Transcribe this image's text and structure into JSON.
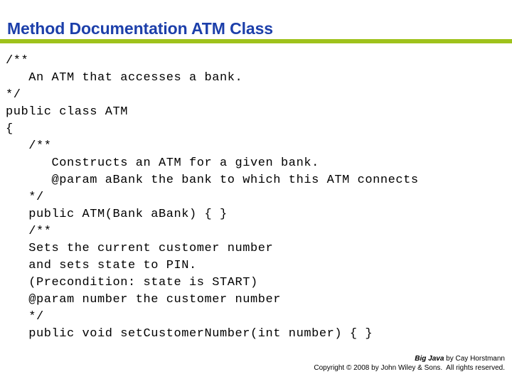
{
  "slide": {
    "title": "Method Documentation ATM Class",
    "accent_color": "#9fc21b",
    "title_color": "#1c3faa",
    "background_color": "#ffffff",
    "text_color": "#000000"
  },
  "code": {
    "language": "java",
    "lines": [
      "/**",
      "   An ATM that accesses a bank.",
      "*/",
      "public class ATM",
      "{",
      "   /**",
      "      Constructs an ATM for a given bank.",
      "      @param aBank the bank to which this ATM connects",
      "   */",
      "   public ATM(Bank aBank) { }",
      "   /**",
      "   Sets the current customer number",
      "   and sets state to PIN.",
      "   (Precondition: state is START)",
      "   @param number the customer number",
      "   */",
      "   public void setCustomerNumber(int number) { }"
    ]
  },
  "footer": {
    "book_title": "Big Java",
    "byline": " by Cay Horstmann",
    "copyright": "Copyright © 2008 by John Wiley & Sons.  All rights reserved."
  }
}
